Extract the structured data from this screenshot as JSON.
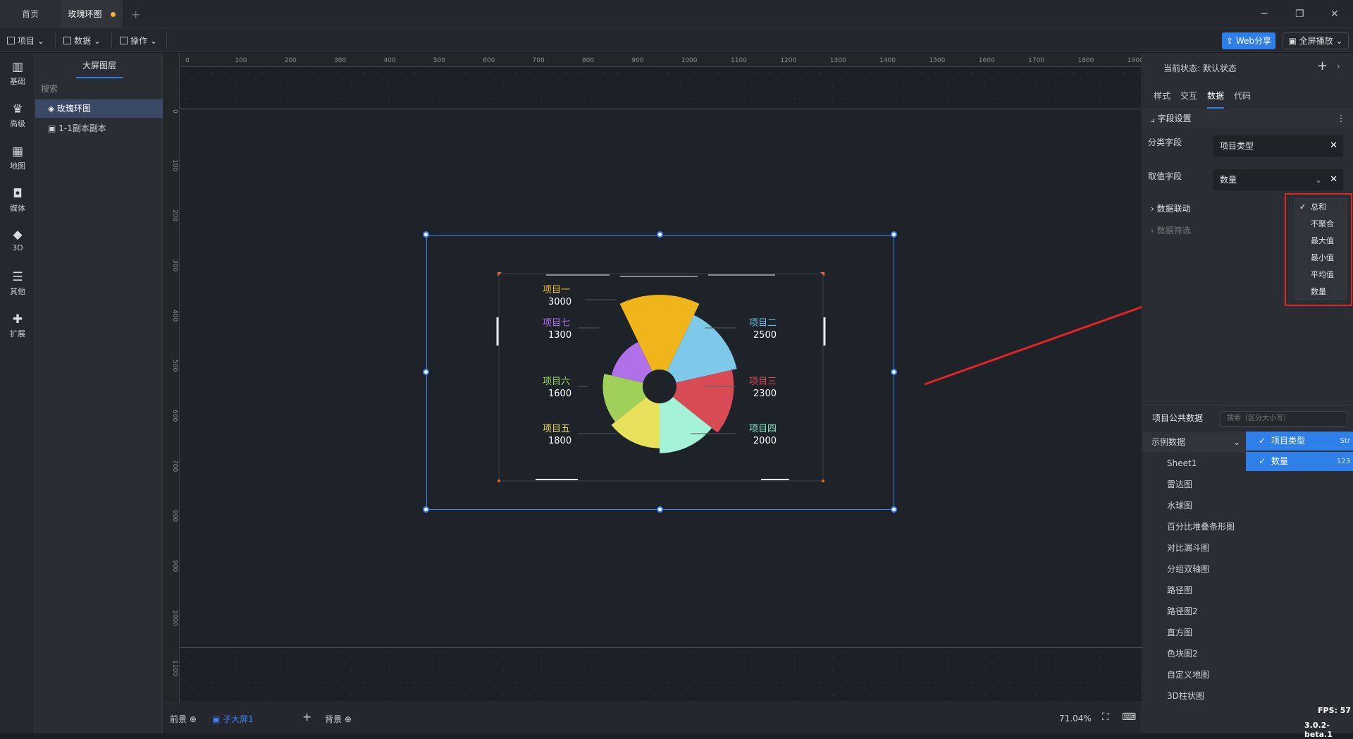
{
  "tabs": {
    "home": "首页",
    "active": "玫瑰环图",
    "add": "+"
  },
  "window": {
    "minimize": "─",
    "restore": "❐",
    "close": "✕"
  },
  "menu": {
    "project": "项目",
    "data": "数据",
    "ops": "操作"
  },
  "toolbar": {
    "share": "Web分享",
    "fullscreen": "全屏播放"
  },
  "leftnav": [
    {
      "label": "基础",
      "icon": "bar-chart-icon",
      "glyph": "▥"
    },
    {
      "label": "高级",
      "icon": "crown-icon",
      "glyph": "♛"
    },
    {
      "label": "地图",
      "icon": "map-icon",
      "glyph": "▦"
    },
    {
      "label": "媒体",
      "icon": "briefcase-icon",
      "glyph": "◘"
    },
    {
      "label": "3D",
      "icon": "cube-icon",
      "glyph": "◆"
    },
    {
      "label": "其他",
      "icon": "list-icon",
      "glyph": "☰"
    },
    {
      "label": "扩展",
      "icon": "puzzle-icon",
      "glyph": "✚"
    }
  ],
  "layers": {
    "title": "大屏图层",
    "search": "搜索",
    "items": [
      {
        "label": "玫瑰环图",
        "icon": "chart-icon"
      },
      {
        "label": "1-1副本副本",
        "icon": "image-icon"
      }
    ]
  },
  "ruler": {
    "h": [
      "0",
      "100",
      "200",
      "300",
      "400",
      "500",
      "600",
      "700",
      "800",
      "900",
      "1000",
      "1100",
      "1200",
      "1300",
      "1400",
      "1500",
      "1600",
      "1700",
      "1800",
      "1900"
    ],
    "v": [
      "0",
      "100",
      "200",
      "300",
      "400",
      "500",
      "600",
      "700",
      "800",
      "900",
      "1000",
      "1100"
    ]
  },
  "chart_data": {
    "type": "pie",
    "variant": "nightingale-rose-ring",
    "categories": [
      "项目一",
      "项目二",
      "项目三",
      "项目四",
      "项目五",
      "项目六",
      "项目七"
    ],
    "values": [
      3000,
      2500,
      2300,
      2000,
      1800,
      1600,
      1300
    ],
    "colors": [
      "#f0b51a",
      "#7ec8ea",
      "#d84b55",
      "#a4f2d8",
      "#e8e15c",
      "#a0d05a",
      "#b070e8"
    ],
    "label_colors": [
      "#f0c030",
      "#6ec0ea",
      "#e0505a",
      "#8ff0d0",
      "#e8e060",
      "#a0d860",
      "#b870f0"
    ]
  },
  "bottom": {
    "foreground": "前景",
    "subscreen": "子大屏1",
    "add": "+",
    "background": "背景",
    "zoom": "71.04%"
  },
  "rightpanel": {
    "state_label": "当前状态:",
    "state_value": "默认状态",
    "tabs": [
      "样式",
      "交互",
      "数据",
      "代码"
    ],
    "field_settings": "字段设置",
    "category_label": "分类字段",
    "category_value": "项目类型",
    "value_label": "取值字段",
    "value_value": "数量",
    "data_link": "数据联动",
    "data_filter": "数据筛选",
    "agg_options": [
      "总和",
      "不聚合",
      "最大值",
      "最小值",
      "平均值",
      "数量"
    ],
    "agg_selected": "总和",
    "common_title": "项目公共数据",
    "common_search_placeholder": "搜索（区分大小写）",
    "tree_root": "示例数据",
    "tree_items": [
      "Sheet1",
      "雷达图",
      "水球图",
      "百分比堆叠条形图",
      "对比漏斗图",
      "分组双轴图",
      "路径图",
      "路径图2",
      "直方图",
      "色块图2",
      "自定义地图",
      "3D柱状图"
    ],
    "columns": [
      {
        "name": "项目类型",
        "type": "Str"
      },
      {
        "name": "数量",
        "type": "123"
      }
    ]
  },
  "status": {
    "fps": "FPS: 57",
    "version": "3.0.2-beta.1"
  }
}
